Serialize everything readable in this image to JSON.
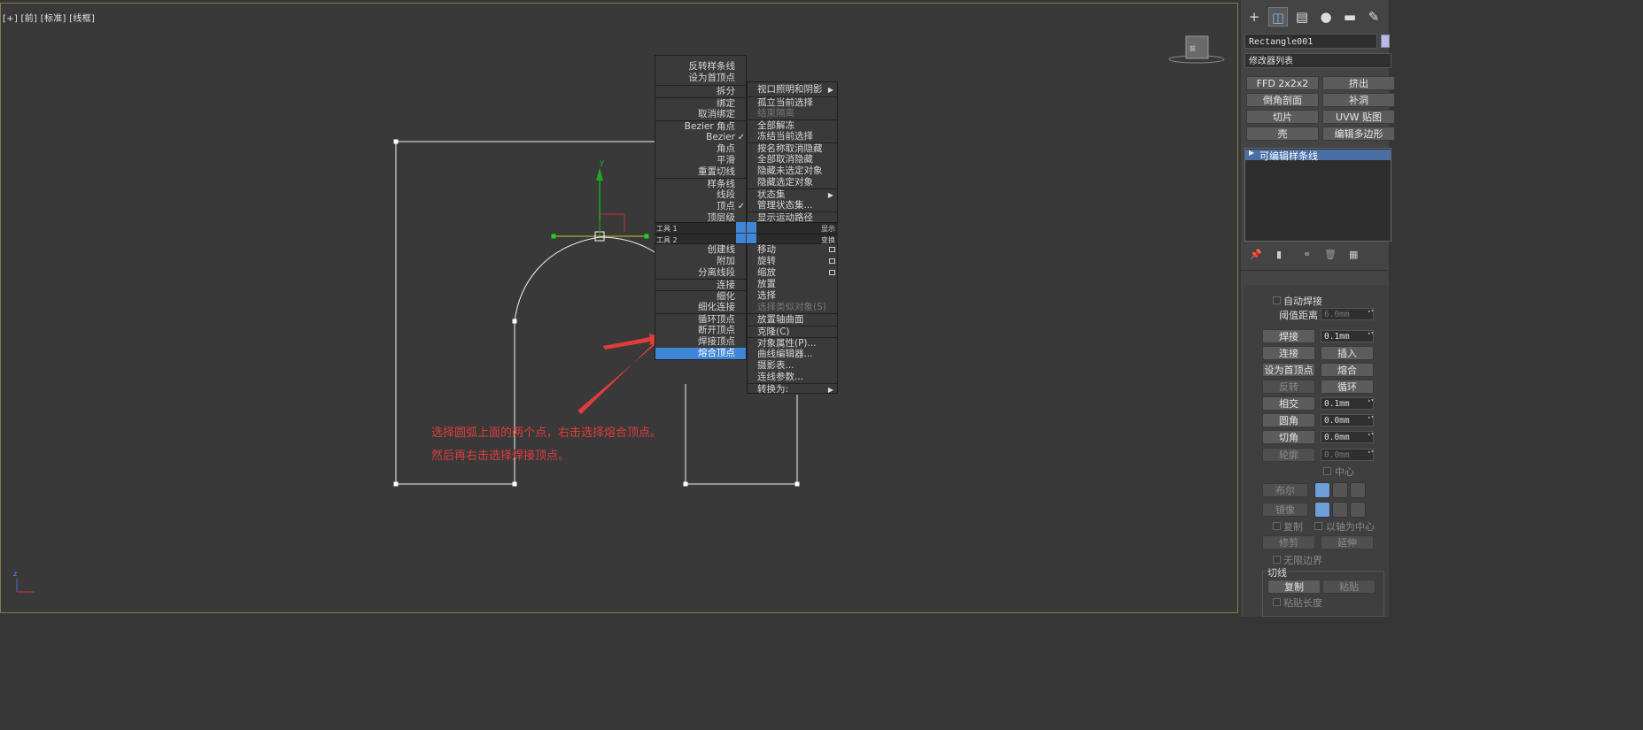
{
  "viewport": {
    "label": "[+] [前] [标准] [线框]",
    "note_line1": "选择圆弧上面的两个点，右击选择熔合顶点。",
    "note_line2": "然后再右击选择焊接顶点。",
    "axis_label": "z"
  },
  "quad_menu": {
    "left_top": [
      "反转样条线",
      "设为首顶点",
      "拆分",
      "绑定",
      "取消绑定",
      "Bezier 角点",
      "Bezier",
      "角点",
      "平滑",
      "重置切线",
      "样条线",
      "线段",
      "顶点",
      "顶层级"
    ],
    "left_bottom": [
      "创建线",
      "附加",
      "分离线段",
      "连接",
      "细化",
      "细化连接",
      "循环顶点",
      "断开顶点",
      "焊接顶点",
      "熔合顶点"
    ],
    "right_top": [
      "视口照明和阴影",
      "孤立当前选择",
      "结束隔离",
      "全部解冻",
      "冻结当前选择",
      "按名称取消隐藏",
      "全部取消隐藏",
      "隐藏未选定对象",
      "隐藏选定对象",
      "状态集",
      "管理状态集...",
      "显示运动路径"
    ],
    "right_bottom": [
      "移动",
      "旋转",
      "缩放",
      "放置",
      "选择",
      "选择类似对象(S)",
      "放置轴曲面",
      "克隆(C)",
      "对象属性(P)...",
      "曲线编辑器...",
      "摄影表...",
      "连线参数...",
      "转换为:"
    ],
    "tool1": "工具 1",
    "tool2": "工具 2",
    "tool1_right": "显示",
    "tool2_right": "变换",
    "highlighted": "熔合顶点"
  },
  "panel": {
    "object_name": "Rectangle001",
    "modifier_list": "修改器列表",
    "buttons": [
      "FFD 2x2x2",
      "挤出",
      "倒角剖面",
      "补洞",
      "切片",
      "UVW 贴图",
      "壳",
      "编辑多边形"
    ],
    "stack_item": "可编辑样条线",
    "auto_weld": "自动焊接",
    "threshold_label": "阈值距离",
    "threshold_value": "6.0mm",
    "weld": "焊接",
    "weld_value": "0.1mm",
    "connect": "连接",
    "insert": "插入",
    "make_first": "设为首顶点",
    "fuse": "熔合",
    "reverse": "反转",
    "cycle": "循环",
    "intersect": "相交",
    "intersect_value": "0.1mm",
    "fillet": "圆角",
    "fillet_value": "0.0mm",
    "chamfer": "切角",
    "chamfer_value": "0.0mm",
    "outline": "轮廓",
    "outline_value": "0.0mm",
    "center": "中心",
    "boolean": "布尔",
    "mirror": "镜像",
    "copy_cb": "复制",
    "about_pivot": "以轴为中心",
    "trim": "修剪",
    "extend": "延伸",
    "infinite": "无限边界",
    "tangent_group": "切线",
    "copy_btn": "复制",
    "paste_btn": "粘贴",
    "paste_length": "粘贴长度"
  }
}
